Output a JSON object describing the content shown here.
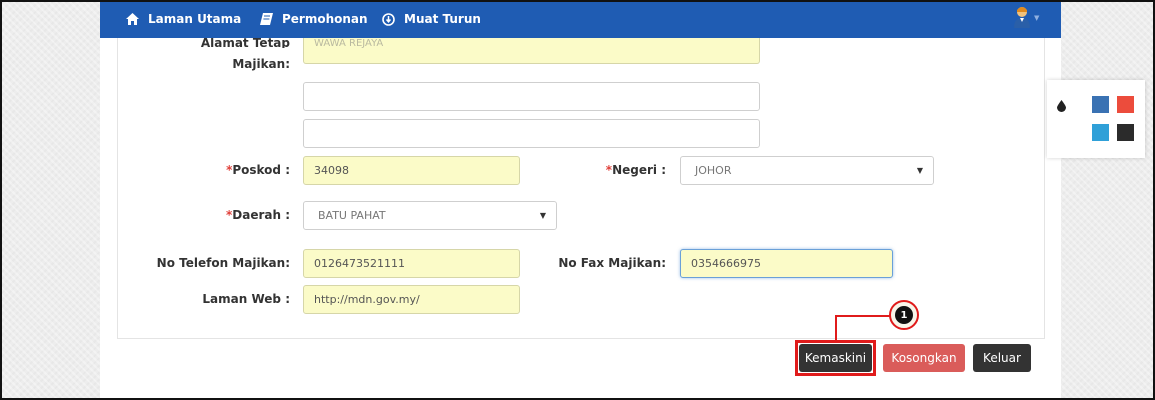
{
  "navbar": {
    "items": [
      {
        "label": "Laman Utama",
        "icon": "home-icon"
      },
      {
        "label": "Permohonan",
        "icon": "book-icon"
      },
      {
        "label": "Muat Turun",
        "icon": "download-circle-icon"
      }
    ],
    "avatar_icon": "user-avatar-icon",
    "colors": {
      "bar": "#1f5cb3"
    }
  },
  "form": {
    "alamat_label_partial": "Alamat Tetap",
    "majikan_label": "Majikan:",
    "alamat_line1_partial": "WAWA REJAYA",
    "poskod": {
      "required_mark": "*",
      "label": "Poskod :",
      "value": "34098"
    },
    "negeri": {
      "required_mark": "*",
      "label": "Negeri :",
      "value": "JOHOR"
    },
    "daerah": {
      "required_mark": "*",
      "label": "Daerah :",
      "value": "BATU PAHAT"
    },
    "telefon": {
      "label": "No Telefon Majikan:",
      "value": "0126473521111"
    },
    "fax": {
      "label": "No Fax Majikan:",
      "value": "0354666975"
    },
    "laman_web": {
      "label": "Laman Web :",
      "value": "http://mdn.gov.my/"
    }
  },
  "buttons": {
    "kemaskini": "Kemaskini",
    "kosongkan": "Kosongkan",
    "keluar": "Keluar"
  },
  "callout": {
    "number": "1",
    "color": "#e01b1b"
  },
  "theme_switcher": {
    "icon": "droplet-icon",
    "colors": [
      "#3a72b3",
      "#ec4c3c",
      "#2fa0d8",
      "#2b2b2b"
    ]
  }
}
